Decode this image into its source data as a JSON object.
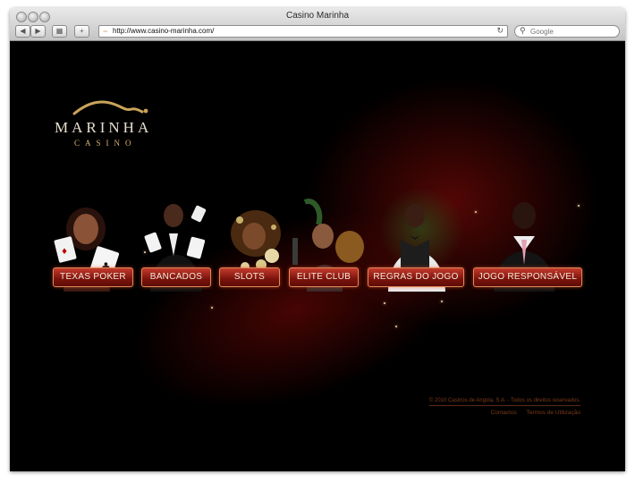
{
  "browser": {
    "window_title": "Casino Marinha",
    "url": "http://www.casino-marinha.com/",
    "search_placeholder": "Google",
    "back_glyph": "◀",
    "forward_glyph": "▶",
    "grid_glyph": "▦",
    "add_glyph": "+",
    "reload_glyph": "↻",
    "search_glyph": "⚲"
  },
  "logo": {
    "name": "MARINHA",
    "sub": "CASINO",
    "colors": {
      "wave": "#c9a35a",
      "name": "#e8e0d0",
      "sub": "#d8b070"
    }
  },
  "menu": {
    "items": [
      {
        "label": "TEXAS POKER"
      },
      {
        "label": "BANCADOS"
      },
      {
        "label": "SLOTS"
      },
      {
        "label": "ELITE CLUB"
      },
      {
        "label": "REGRAS DO JOGO"
      },
      {
        "label": "JOGO RESPONSÁVEL"
      }
    ]
  },
  "footer": {
    "copyright": "© 2010 Casinos de Angola, S.A. - Todos os direitos reservados.",
    "links": [
      "Contactos",
      "Termos de Utilização"
    ]
  },
  "colors": {
    "background": "#000000",
    "accent_red": "#a8150e",
    "button_border": "#e08a5a",
    "footer_text": "#7d3a1a"
  }
}
